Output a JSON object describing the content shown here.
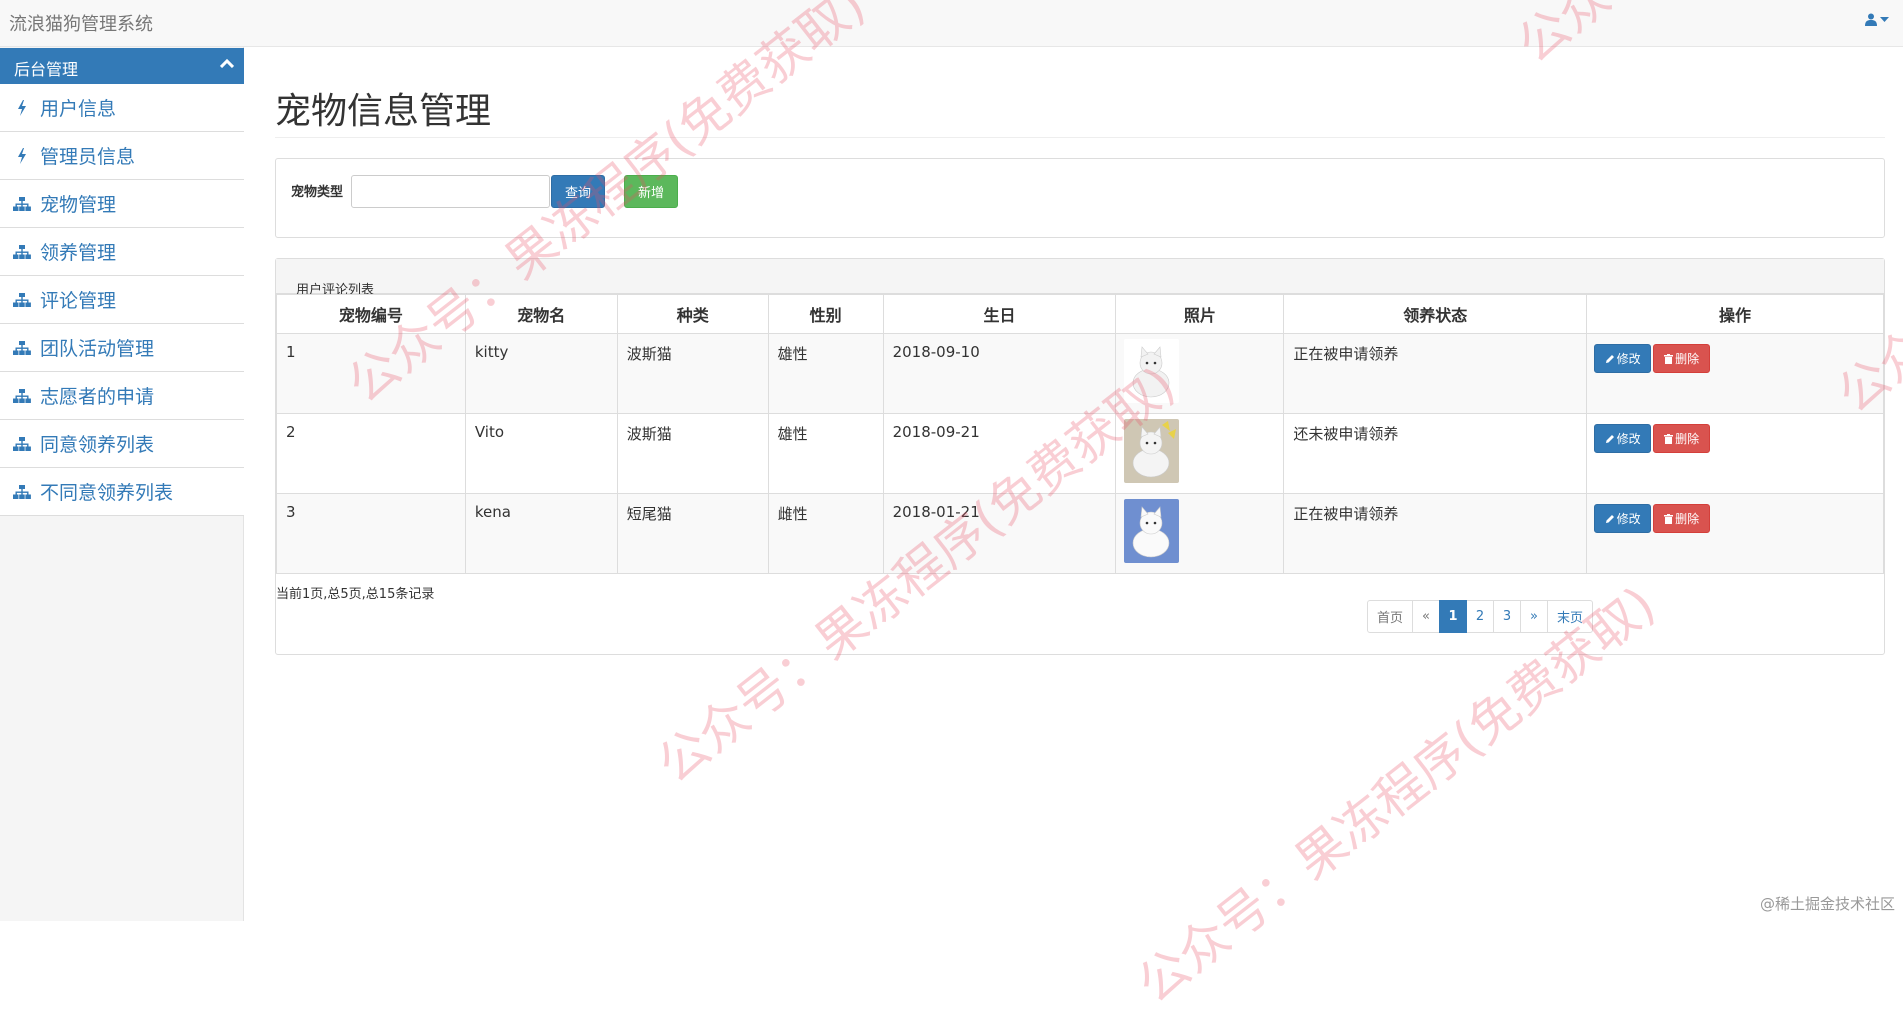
{
  "app": {
    "title": "流浪猫狗管理系统"
  },
  "sidebar": {
    "header": "后台管理",
    "items": [
      {
        "label": "用户信息",
        "icon": "bolt-icon"
      },
      {
        "label": "管理员信息",
        "icon": "bolt-icon"
      },
      {
        "label": "宠物管理",
        "icon": "sitemap-icon"
      },
      {
        "label": "领养管理",
        "icon": "sitemap-icon"
      },
      {
        "label": "评论管理",
        "icon": "sitemap-icon"
      },
      {
        "label": "团队活动管理",
        "icon": "sitemap-icon"
      },
      {
        "label": "志愿者的申请",
        "icon": "sitemap-icon"
      },
      {
        "label": "同意领养列表",
        "icon": "sitemap-icon"
      },
      {
        "label": "不同意领养列表",
        "icon": "sitemap-icon"
      }
    ]
  },
  "main": {
    "title": "宠物信息管理",
    "search": {
      "label": "宠物类型",
      "value": "",
      "query_label": "查询",
      "add_label": "新增"
    },
    "table": {
      "caption": "用户评论列表",
      "headers": [
        "宠物编号",
        "宠物名",
        "种类",
        "性别",
        "生日",
        "照片",
        "领养状态",
        "操作"
      ],
      "rows": [
        {
          "id": "1",
          "name": "kitty",
          "kind": "波斯猫",
          "gender": "雄性",
          "birthday": "2018-09-10",
          "status": "正在被申请领养"
        },
        {
          "id": "2",
          "name": "Vito",
          "kind": "波斯猫",
          "gender": "雄性",
          "birthday": "2018-09-21",
          "status": "还未被申请领养"
        },
        {
          "id": "3",
          "name": "kena",
          "kind": "短尾猫",
          "gender": "雌性",
          "birthday": "2018-01-21",
          "status": "正在被申请领养"
        }
      ],
      "edit_label": "修改",
      "delete_label": "删除"
    },
    "pagination": {
      "summary": "当前1页,总5页,总15条记录",
      "first": "首页",
      "prev": "«",
      "pages": [
        "1",
        "2",
        "3"
      ],
      "current": "1",
      "next": "»",
      "last": "末页"
    }
  },
  "watermark": "公众号：果冻程序(免费获取)",
  "credit": "@稀土掘金技术社区",
  "colors": {
    "primary": "#337ab7",
    "success": "#5cb85c",
    "danger": "#d9534f"
  }
}
